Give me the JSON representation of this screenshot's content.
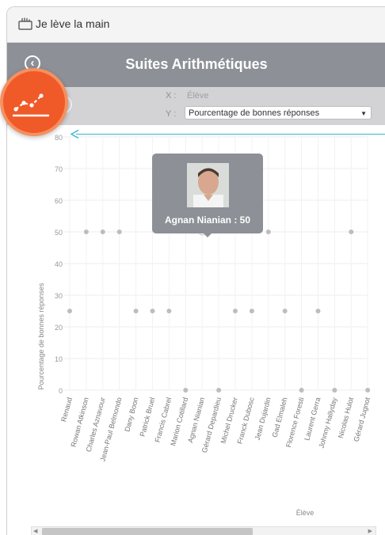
{
  "app": {
    "title": "Je lève la main",
    "icon": "raised-hand-icon"
  },
  "header": {
    "title": "Suites Arithmétiques",
    "back_icon": "chevron-left-icon"
  },
  "controls": {
    "x_label": "X :",
    "x_value": "Élève",
    "y_label": "Y :",
    "y_value": "Pourcentage de bonnes réponses",
    "pause_icon": "pause-icon",
    "badge_icon": "line-chart-icon"
  },
  "tooltip": {
    "text": "Agnan Nianian : 50",
    "photo": "student-photo"
  },
  "colors": {
    "accent": "#f05a28",
    "header": "#8d9096",
    "toolbar": "#d3d3d6",
    "arrow": "#3bb5cf",
    "points": "#bdbdbd"
  },
  "chart_data": {
    "type": "scatter",
    "xlabel": "Élève",
    "ylabel": "Pourcentage de bonnes réponses",
    "ylim": [
      0,
      80
    ],
    "yticks": [
      0,
      10,
      20,
      30,
      40,
      50,
      60,
      70,
      80
    ],
    "categories": [
      "Renaud",
      "Rowan Atkinson",
      "Charles Aznavour",
      "Jean-Paul Belmondo",
      "Dany Boon",
      "Patrick Bruel",
      "Francis Cabrel",
      "Marion Cotillard",
      "Agnan Nianian",
      "Gérard Depardieu",
      "Michel Drucker",
      "Franck Dubosc",
      "Jean Dujardin",
      "Gad Elmaleh",
      "Florence Foresti",
      "Laurent Gerra",
      "Johnny Hallyday",
      "Nicolas Hulot",
      "Gérard Jugnot"
    ],
    "values": [
      25,
      50,
      50,
      50,
      25,
      25,
      25,
      0,
      50,
      0,
      25,
      25,
      50,
      25,
      0,
      25,
      0,
      50,
      0
    ],
    "grid": true,
    "highlighted": "Agnan Nianian"
  }
}
